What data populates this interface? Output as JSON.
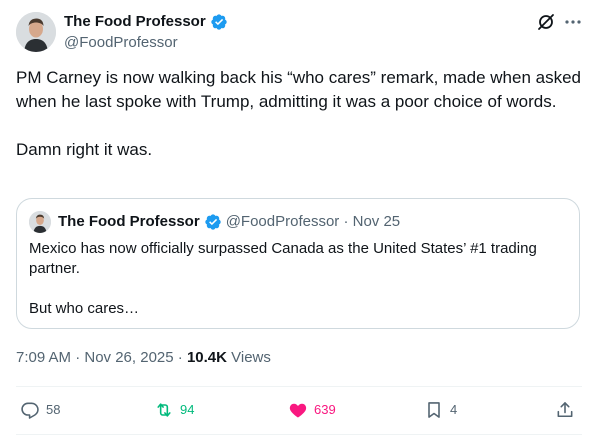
{
  "author": {
    "display_name": "The Food Professor",
    "handle": "@FoodProfessor"
  },
  "tweet": {
    "text": "PM Carney is now walking back his “who cares” remark, made when asked when he last spoke with Trump, admitting it was a poor choice of words.\n\nDamn right it was."
  },
  "quoted_tweet": {
    "display_name": "The Food Professor",
    "meta": "@FoodProfessor · Nov 25",
    "text": "Mexico has now officially surpassed Canada as the United States’ #1 trading partner.\n\nBut who cares…"
  },
  "meta": {
    "timestamp": "7:09 AM · Nov 26, 2025 · ",
    "views_count": "10.4K",
    "views_label": " Views"
  },
  "actions": {
    "replies": "58",
    "reposts": "94",
    "likes": "639",
    "bookmarks": "4"
  },
  "icons": {
    "verified": "verified-badge-icon",
    "grok": "grok-icon",
    "more": "more-icon",
    "reply": "reply-icon",
    "repost": "repost-icon",
    "like": "heart-icon",
    "bookmark": "bookmark-icon",
    "share": "share-icon"
  },
  "colors": {
    "verified": "#1d9bf0",
    "repost_active": "#00ba7c",
    "like_active": "#f91880",
    "secondary_text": "#536471"
  }
}
